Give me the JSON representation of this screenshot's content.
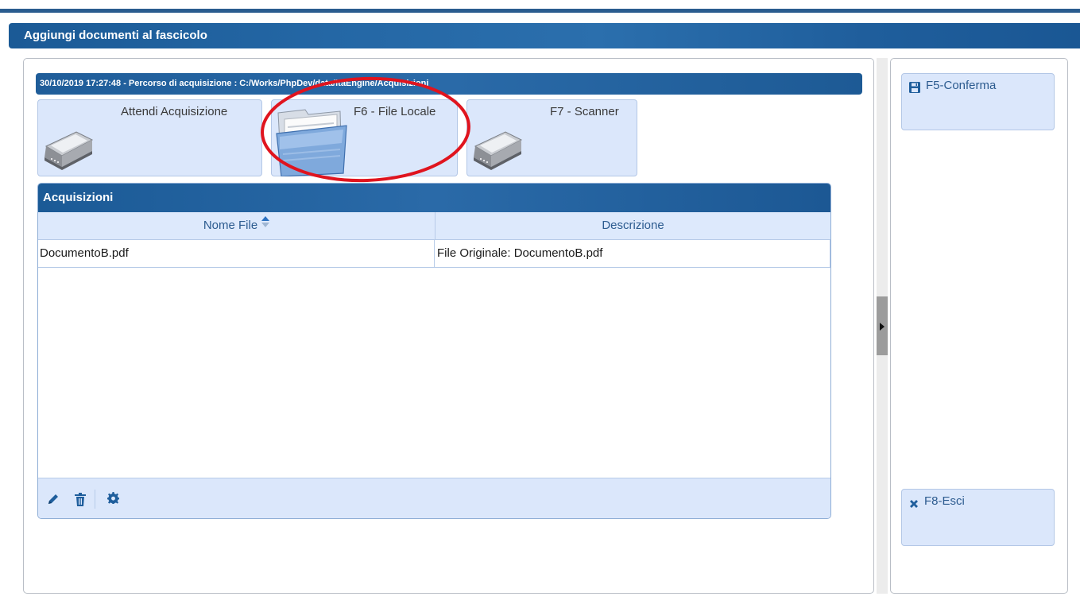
{
  "window": {
    "title": "Aggiungi documenti al fascicolo"
  },
  "acquisition": {
    "path_text": "30/10/2019 17:27:48 - Percorso di acquisizione : C:/Works/PhpDev/data/itaEngine/Acquisizioni",
    "buttons": [
      {
        "label": "Attendi Acquisizione",
        "icon": "scanner-icon"
      },
      {
        "label": "F6 - File Locale",
        "icon": "folder-icon"
      },
      {
        "label": "F7 - Scanner",
        "icon": "scanner-icon"
      }
    ]
  },
  "grid": {
    "caption": "Acquisizioni",
    "columns": [
      "Nome File",
      "Descrizione"
    ],
    "rows": [
      {
        "nome_file": "DocumentoB.pdf",
        "descrizione": "File Originale: DocumentoB.pdf"
      }
    ],
    "footer_icons": [
      "pencil-icon",
      "trash-icon",
      "gear-icon"
    ]
  },
  "side": {
    "confirm_label": "F5-Conferma",
    "exit_label": "F8-Esci"
  },
  "colors": {
    "header_blue": "#1f5e9c",
    "button_bg": "#dbe7fb",
    "annotation_red": "#e0141e"
  }
}
